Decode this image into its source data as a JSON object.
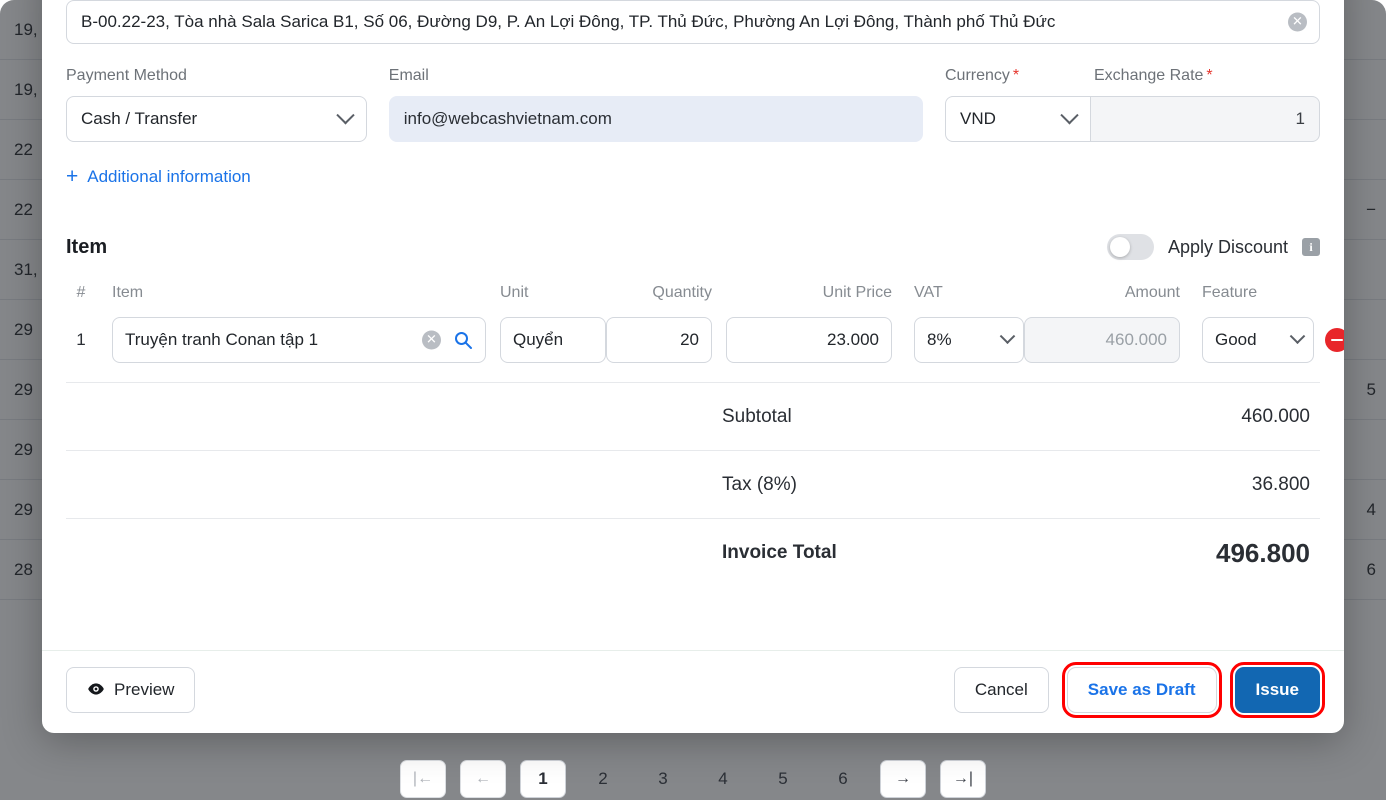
{
  "background": {
    "rows": [
      {
        "left": "19,",
        "right": ""
      },
      {
        "left": "19,",
        "right": ""
      },
      {
        "left": "22",
        "right": ""
      },
      {
        "left": "22",
        "right": "−"
      },
      {
        "left": "31,",
        "right": ""
      },
      {
        "left": "29",
        "right": ""
      },
      {
        "left": "29",
        "right": "5"
      },
      {
        "left": "29",
        "right": ""
      },
      {
        "left": "29",
        "right": "4"
      },
      {
        "left": "28",
        "right": "6"
      }
    ]
  },
  "pagination": {
    "first_label": "|←",
    "prev_label": "←",
    "pages": [
      "1",
      "2",
      "3",
      "4",
      "5",
      "6"
    ],
    "active_page": "1",
    "next_label": "→",
    "last_label": "→|"
  },
  "modal": {
    "address": {
      "value": "B-00.22-23, Tòa nhà Sala Sarica B1, Số 06, Đường D9, P. An Lợi Đông, TP. Thủ Đức, Phường An Lợi Đông, Thành phố Thủ Đức",
      "clear_icon": "clear-icon"
    },
    "payment_method": {
      "label": "Payment Method",
      "value": "Cash / Transfer"
    },
    "email": {
      "label": "Email",
      "value": "info@webcashvietnam.com"
    },
    "currency": {
      "label": "Currency",
      "required_mark": "*",
      "value": "VND"
    },
    "exchange_rate": {
      "label": "Exchange Rate",
      "required_mark": "*",
      "value": "1"
    },
    "additional_information": {
      "plus": "+",
      "label": "Additional information"
    },
    "item_section": {
      "title": "Item",
      "apply_discount_label": "Apply Discount",
      "apply_discount_on": false,
      "info_icon_label": "i",
      "columns": {
        "num": "#",
        "item": "Item",
        "unit": "Unit",
        "quantity": "Quantity",
        "unit_price": "Unit Price",
        "vat": "VAT",
        "amount": "Amount",
        "feature": "Feature"
      },
      "rows": [
        {
          "num": "1",
          "item": "Truyện tranh Conan tập 1",
          "unit": "Quyển",
          "quantity": "20",
          "unit_price": "23.000",
          "vat": "8%",
          "amount": "460.000",
          "feature": "Good"
        }
      ]
    },
    "totals": [
      {
        "label": "Subtotal",
        "value": "460.000",
        "emphasis": false
      },
      {
        "label": "Tax (8%)",
        "value": "36.800",
        "emphasis": false
      },
      {
        "label": "Invoice Total",
        "value": "496.800",
        "emphasis": true
      }
    ],
    "footer": {
      "preview_label": "Preview",
      "cancel_label": "Cancel",
      "save_draft_label": "Save as Draft",
      "issue_label": "Issue"
    }
  },
  "colors": {
    "accent_blue": "#1a73e8",
    "primary_button": "#1267b2",
    "required_red": "#e5342c",
    "remove_red": "#e8262a",
    "highlight_red": "#ff0000",
    "email_field_bg": "#e7ecf6"
  }
}
